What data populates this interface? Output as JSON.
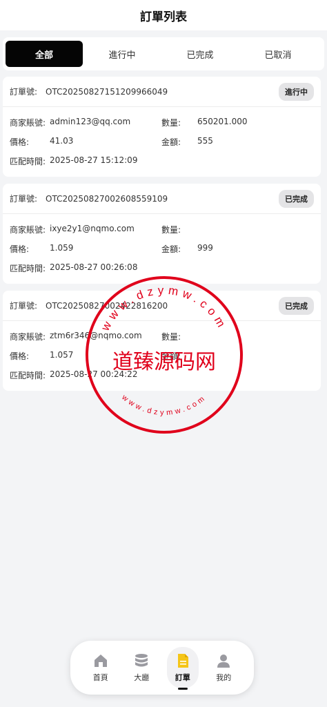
{
  "header": {
    "title": "訂單列表"
  },
  "tabs": [
    {
      "label": "全部",
      "active": true
    },
    {
      "label": "進行中",
      "active": false
    },
    {
      "label": "已完成",
      "active": false
    },
    {
      "label": "已取消",
      "active": false
    }
  ],
  "labels": {
    "order_no": "訂單號:",
    "merchant": "商家賬號:",
    "quantity": "數量:",
    "price": "價格:",
    "amount": "金額:",
    "match_time": "匹配時間:"
  },
  "orders": [
    {
      "order_no": "OTC2025082715120996​6049",
      "status": "進行中",
      "merchant": "admin123@qq.com",
      "quantity": "650201.000",
      "price": "41.03",
      "amount": "555",
      "match_time": "2025-08-27 15:12:09"
    },
    {
      "order_no": "OTC2025082700260855​9109",
      "status": "已完成",
      "merchant": "ixye2y1@nqmo.com",
      "quantity": "",
      "price": "1.059",
      "amount": "999",
      "match_time": "2025-08-27 00:26:08"
    },
    {
      "order_no": "OTC2025082700242281​6200",
      "status": "已完成",
      "merchant": "ztm6r346@nqmo.com",
      "quantity": "",
      "price": "1.057",
      "amount": "",
      "match_time": "2025-08-27 00:24:22"
    }
  ],
  "watermark": {
    "center_text": "道臻源码网",
    "ring_text": "www.dzymw.com",
    "color": "#e0001b"
  },
  "nav": [
    {
      "label": "首頁",
      "icon": "home-icon",
      "active": false
    },
    {
      "label": "大廳",
      "icon": "database-icon",
      "active": false
    },
    {
      "label": "訂單",
      "icon": "document-icon",
      "active": true
    },
    {
      "label": "我的",
      "icon": "user-icon",
      "active": false
    }
  ]
}
